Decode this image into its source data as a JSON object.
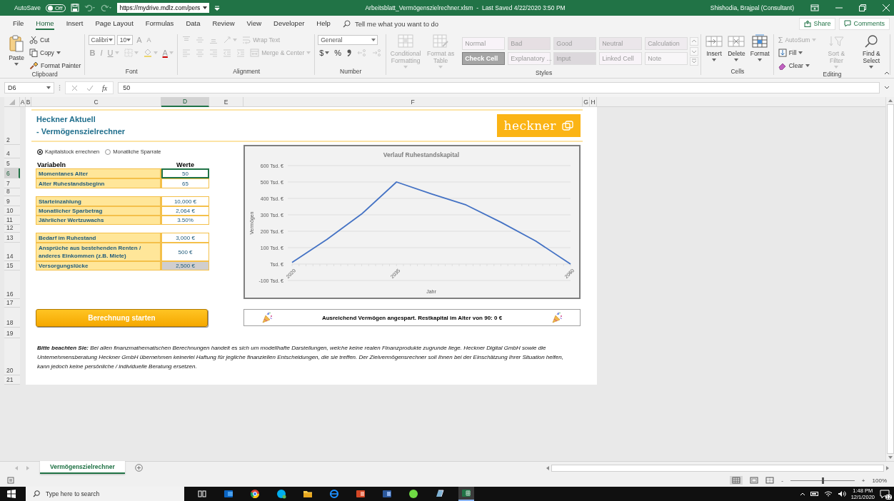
{
  "title_bar": {
    "autosave_label": "AutoSave",
    "autosave": {
      "on": false,
      "label": "Off"
    },
    "url": "https://mydrive.mdlz.com/pers",
    "title": "Arbeitsblatt_Vermögenszielrechner.xlsm  -  Last Saved 4/22/2020 3:50 PM",
    "user": "Shishodia, Brajpal (Consultant)"
  },
  "menu_tabs": [
    {
      "label": "File",
      "selected": false
    },
    {
      "label": "Home",
      "selected": true
    },
    {
      "label": "Insert",
      "selected": false
    },
    {
      "label": "Page Layout",
      "selected": false
    },
    {
      "label": "Formulas",
      "selected": false
    },
    {
      "label": "Data",
      "selected": false
    },
    {
      "label": "Review",
      "selected": false
    },
    {
      "label": "View",
      "selected": false
    },
    {
      "label": "Developer",
      "selected": false
    },
    {
      "label": "Help",
      "selected": false
    }
  ],
  "tell_me": {
    "placeholder": "Tell me what you want to do"
  },
  "share_button": "Share",
  "comments_button": "Comments",
  "ribbon": [
    {
      "label": "Clipboard",
      "blocks": [
        {
          "kind": "large",
          "label": "Paste",
          "disabled": false,
          "dropdown": true
        },
        {
          "kind": "stack",
          "rows": [
            {
              "items": [
                {
                  "kind": "small",
                  "label": "Cut",
                  "disabled": false,
                  "dropdown": false
                }
              ]
            },
            {
              "items": [
                {
                  "kind": "small",
                  "label": "Copy",
                  "disabled": false,
                  "dropdown": true
                }
              ]
            },
            {
              "items": [
                {
                  "kind": "small",
                  "label": "Format Painter",
                  "disabled": false,
                  "dropdown": false
                }
              ]
            }
          ]
        }
      ]
    },
    {
      "label": "Font",
      "blocks": [
        {
          "kind": "stack",
          "rows": [
            {
              "items": [
                {
                  "kind": "field",
                  "value": "Calibri"
                },
                {
                  "kind": "field",
                  "value": "10"
                },
                {
                  "kind": "glyph",
                  "label": "A",
                  "disabled": true,
                  "dropdown": false
                },
                {
                  "kind": "glyph",
                  "label": "A",
                  "disabled": true,
                  "dropdown": false
                }
              ]
            },
            {
              "items": [
                {
                  "kind": "glyph",
                  "label": "B",
                  "disabled": true,
                  "dropdown": false
                },
                {
                  "kind": "glyph",
                  "label": "I",
                  "disabled": true,
                  "dropdown": false
                },
                {
                  "kind": "glyph",
                  "label": "U",
                  "disabled": true,
                  "dropdown": true
                },
                {
                  "kind": "icon",
                  "disabled": true,
                  "dropdown": true
                },
                {
                  "kind": "icon",
                  "disabled": true,
                  "dropdown": true
                },
                {
                  "kind": "glyph",
                  "label": "A",
                  "disabled": true,
                  "dropdown": true
                }
              ]
            }
          ]
        }
      ]
    },
    {
      "label": "Alignment",
      "blocks": [
        {
          "kind": "stack",
          "rows": [
            {
              "items": [
                {
                  "kind": "icon",
                  "disabled": true,
                  "dropdown": false
                },
                {
                  "kind": "icon",
                  "disabled": true,
                  "dropdown": false
                },
                {
                  "kind": "icon",
                  "disabled": true,
                  "dropdown": false
                },
                {
                  "kind": "icon",
                  "disabled": true,
                  "dropdown": true
                },
                {
                  "kind": "small",
                  "label": "Wrap Text",
                  "disabled": true,
                  "dropdown": false
                }
              ]
            },
            {
              "items": [
                {
                  "kind": "icon",
                  "disabled": true,
                  "dropdown": false
                },
                {
                  "kind": "icon",
                  "disabled": true,
                  "dropdown": false
                },
                {
                  "kind": "icon",
                  "disabled": true,
                  "dropdown": false
                },
                {
                  "kind": "icon",
                  "disabled": true,
                  "dropdown": false
                },
                {
                  "kind": "icon",
                  "disabled": true,
                  "dropdown": false
                },
                {
                  "kind": "small",
                  "label": "Merge & Center",
                  "disabled": true,
                  "dropdown": true
                }
              ]
            }
          ]
        }
      ]
    },
    {
      "label": "Number",
      "blocks": [
        {
          "kind": "stack",
          "rows": [
            {
              "items": [
                {
                  "kind": "field",
                  "value": "General"
                }
              ]
            },
            {
              "items": [
                {
                  "kind": "glyph",
                  "label": "$",
                  "disabled": false,
                  "dropdown": true
                },
                {
                  "kind": "glyph",
                  "label": "%",
                  "disabled": false,
                  "dropdown": false
                },
                {
                  "kind": "icon",
                  "disabled": false,
                  "dropdown": false
                },
                {
                  "kind": "icon",
                  "disabled": true,
                  "dropdown": false
                },
                {
                  "kind": "icon",
                  "disabled": true,
                  "dropdown": false
                }
              ]
            }
          ]
        }
      ]
    },
    {
      "label": "Styles",
      "blocks": [
        {
          "kind": "large",
          "label": "Conditional Formatting",
          "disabled": true,
          "dropdown": true
        },
        {
          "kind": "large",
          "label": "Format as Table",
          "disabled": true,
          "dropdown": true
        },
        {
          "kind": "styles",
          "cells": [
            {
              "label": "Normal",
              "color": "#f8f3f8"
            },
            {
              "label": "Bad",
              "color": "#e6dfe3"
            },
            {
              "label": "Good",
              "color": "#e3dfe3"
            },
            {
              "label": "Neutral",
              "color": "#ebe6ea"
            },
            {
              "label": "Calculation",
              "color": "#efebef"
            },
            {
              "label": "Check Cell",
              "color": "#a5a5a5"
            },
            {
              "label": "Explanatory ...",
              "color": "#f8f3f8"
            },
            {
              "label": "Input",
              "color": "#dcd8dc"
            },
            {
              "label": "Linked Cell",
              "color": "#f8f3f8"
            },
            {
              "label": "Note",
              "color": "#f8f6f8"
            }
          ]
        }
      ]
    },
    {
      "label": "Cells",
      "blocks": [
        {
          "kind": "large",
          "label": "Insert",
          "disabled": false,
          "dropdown": true
        },
        {
          "kind": "large",
          "label": "Delete",
          "disabled": false,
          "dropdown": true
        },
        {
          "kind": "large",
          "label": "Format",
          "disabled": false,
          "dropdown": true
        }
      ]
    },
    {
      "label": "Editing",
      "blocks": [
        {
          "kind": "stack",
          "rows": [
            {
              "items": [
                {
                  "kind": "small",
                  "icon_text": "Σ",
                  "label": "AutoSum",
                  "disabled": true,
                  "dropdown": true
                }
              ]
            },
            {
              "items": [
                {
                  "kind": "small",
                  "label": "Fill",
                  "disabled": false,
                  "dropdown": true
                }
              ]
            },
            {
              "items": [
                {
                  "kind": "small",
                  "label": "Clear",
                  "disabled": false,
                  "dropdown": true
                }
              ]
            }
          ]
        },
        {
          "kind": "large",
          "label": "Sort & Filter",
          "disabled": true,
          "dropdown": true
        },
        {
          "kind": "large",
          "label": "Find & Select",
          "disabled": false,
          "dropdown": true
        }
      ]
    }
  ],
  "formula_bar": {
    "name_box": "D6",
    "function_button": "fx",
    "value": "50"
  },
  "columns": [
    {
      "label": "A",
      "selected": false
    },
    {
      "label": "B",
      "selected": false
    },
    {
      "label": "C",
      "selected": false
    },
    {
      "label": "D",
      "selected": true
    },
    {
      "label": "E",
      "selected": false
    },
    {
      "label": "F",
      "selected": false
    },
    {
      "label": "G",
      "selected": false
    },
    {
      "label": "H",
      "selected": false
    }
  ],
  "rows": [
    {
      "label": "2",
      "selected": false
    },
    {
      "label": "4",
      "selected": false
    },
    {
      "label": "5",
      "selected": false
    },
    {
      "label": "6",
      "selected": true
    },
    {
      "label": "7",
      "selected": false
    },
    {
      "label": "8",
      "selected": false
    },
    {
      "label": "9",
      "selected": false
    },
    {
      "label": "10",
      "selected": false
    },
    {
      "label": "11",
      "selected": false
    },
    {
      "label": "12",
      "selected": false
    },
    {
      "label": "13",
      "selected": false
    },
    {
      "label": "14",
      "selected": false
    },
    {
      "label": "15",
      "selected": false
    },
    {
      "label": "16",
      "selected": false
    },
    {
      "label": "17",
      "selected": false
    },
    {
      "label": "18",
      "selected": false
    },
    {
      "label": "19",
      "selected": false
    },
    {
      "label": "20",
      "selected": false
    },
    {
      "label": "21",
      "selected": false
    }
  ],
  "sheet": {
    "title": "Heckner Aktuell",
    "subtitle": "- Vermögenszielrechner",
    "logo": "heckner",
    "mode_options": [
      {
        "label": "Kapitalstock errechnen",
        "selected": true
      },
      {
        "label": "Monatliche Sparrate",
        "selected": false
      }
    ],
    "variables_header": "Variabeln",
    "values_header": "Werte",
    "variable_groups": [
      [
        {
          "label": "Momentanes Alter",
          "value": "50",
          "kind": "input",
          "selected": true
        },
        {
          "label": "Alter Ruhestandsbeginn",
          "value": "65",
          "kind": "input",
          "selected": false
        }
      ],
      [
        {
          "label": "Starteinzahlung",
          "value": "10,000 €",
          "kind": "input",
          "selected": false
        },
        {
          "label": "Monatlicher Sparbetrag",
          "value": "2,064 €",
          "kind": "input",
          "selected": false
        },
        {
          "label": "Jährlicher Wertzuwachs",
          "value": "3.50%",
          "kind": "input",
          "selected": false
        }
      ],
      [
        {
          "label": "Bedarf im Ruhestand",
          "value": "3,000 €",
          "kind": "input",
          "selected": false
        },
        {
          "label": "Ansprüche aus bestehenden Renten / anderes Einkommen (z.B. Miete)",
          "value": "500 €",
          "kind": "input",
          "selected": false
        },
        {
          "label": "Versorgungslücke",
          "value": "2,500 €",
          "kind": "computed",
          "selected": false
        }
      ]
    ],
    "start_button": "Berechnung starten",
    "chart_data": {
      "type": "line",
      "title": "Verlauf Ruhestandskapital",
      "xlabel": "Jahr",
      "ylabel": "Vermögen",
      "grid": true,
      "x": [
        2020,
        2025,
        2030,
        2035,
        2040,
        2045,
        2050,
        2055,
        2060
      ],
      "series": [
        {
          "color": "#4472c4",
          "values": [
            10,
            150,
            305,
            500,
            428,
            360,
            255,
            140,
            0
          ]
        }
      ],
      "xlim": [
        2020,
        2060
      ],
      "ylim": [
        -100,
        600
      ],
      "xticks": [
        2020,
        2035,
        2060
      ],
      "yticks": [
        {
          "value": 600,
          "label": "600 Tsd. €"
        },
        {
          "value": 500,
          "label": "500 Tsd. €"
        },
        {
          "value": 400,
          "label": "400 Tsd. €"
        },
        {
          "value": 300,
          "label": "300 Tsd. €"
        },
        {
          "value": 200,
          "label": "200 Tsd. €"
        },
        {
          "value": 100,
          "label": "100 Tsd. €"
        },
        {
          "value": 0,
          "label": "Tsd. €"
        },
        {
          "value": -100,
          "label": "-100 Tsd. €"
        }
      ]
    },
    "result_message": "Ausreichend Vermögen angespart. Restkapital im Alter von 90: 0 €",
    "note": "**Bitte beachten Sie:**  Bei allen finanzmathematischen Berechnungen handelt es sich um modellhafte Darstellungen, welche keine realen Finanzprodukte zugrunde liege. Heckner Digital GmbH sowie die Unternehmensberatung Heckner GmbH übernehmen keinerlei Haftung für jegliche finanziellen Entscheidungen, die sie treffen. Der Zielvermögensrechner soll Ihnen bei der Einschätzung Ihrer Situation helfen, kann jedoch keine persönliche / individuelle Beratung ersetzen."
  },
  "sheet_tabs": [
    {
      "label": "Vermögenszielrechner",
      "selected": true
    }
  ],
  "status_bar": {
    "zoom": {
      "minus": "-",
      "plus": "+",
      "level": 0.5,
      "reading": "100%"
    }
  },
  "taskbar": {
    "search": {
      "placeholder": "Type here to search"
    },
    "time": "1:48 PM",
    "date": "12/1/2020",
    "notification_count": "12"
  }
}
